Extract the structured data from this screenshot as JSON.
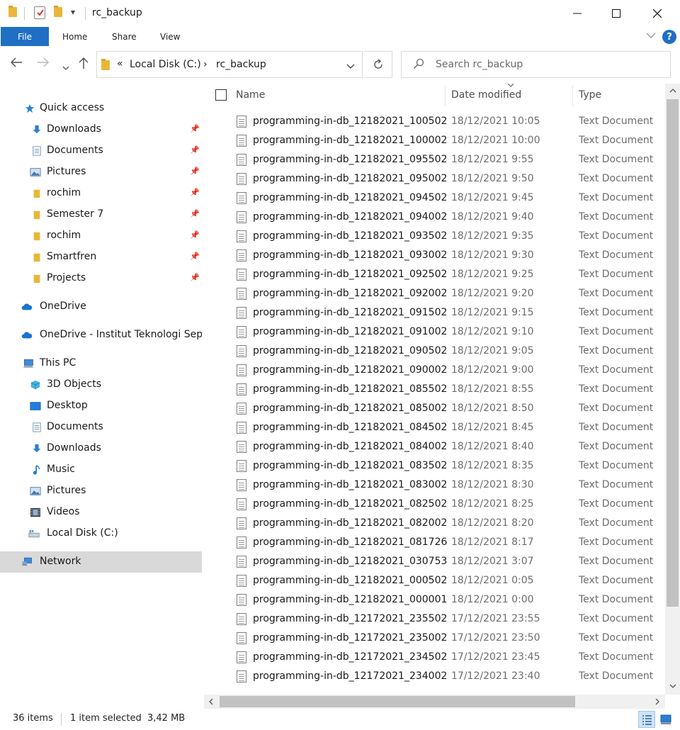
{
  "window": {
    "title": "rc_backup",
    "minimize_icon": "minimize-icon",
    "maximize_icon": "maximize-icon",
    "close_icon": "close-icon",
    "qa_dropdown": "▾"
  },
  "ribbon": {
    "tabs": [
      "File",
      "Home",
      "Share",
      "View"
    ],
    "help": "?"
  },
  "address": {
    "overflow": "«",
    "parts": [
      "Local Disk (C:)",
      "rc_backup"
    ],
    "separator": "›"
  },
  "search": {
    "placeholder": "Search rc_backup"
  },
  "sidebar": {
    "quick_access": "Quick access",
    "quick_items": [
      "Downloads",
      "Documents",
      "Pictures",
      "rochim",
      "Semester 7",
      "rochim",
      "Smartfren",
      "Projects"
    ],
    "onedrive": "OneDrive",
    "onedrive_org": "OneDrive - Institut Teknologi Sepuluh Nopember",
    "this_pc": "This PC",
    "pc_items": [
      "3D Objects",
      "Desktop",
      "Documents",
      "Downloads",
      "Music",
      "Pictures",
      "Videos",
      "Local Disk (C:)"
    ],
    "network": "Network"
  },
  "columns": {
    "name": "Name",
    "date": "Date modified",
    "type": "Type"
  },
  "files": [
    {
      "name": "programming-in-db_12182021_100502",
      "date": "18/12/2021 10:05",
      "type": "Text Document"
    },
    {
      "name": "programming-in-db_12182021_100002",
      "date": "18/12/2021 10:00",
      "type": "Text Document"
    },
    {
      "name": "programming-in-db_12182021_095502",
      "date": "18/12/2021 9:55",
      "type": "Text Document"
    },
    {
      "name": "programming-in-db_12182021_095002",
      "date": "18/12/2021 9:50",
      "type": "Text Document"
    },
    {
      "name": "programming-in-db_12182021_094502",
      "date": "18/12/2021 9:45",
      "type": "Text Document"
    },
    {
      "name": "programming-in-db_12182021_094002",
      "date": "18/12/2021 9:40",
      "type": "Text Document"
    },
    {
      "name": "programming-in-db_12182021_093502",
      "date": "18/12/2021 9:35",
      "type": "Text Document"
    },
    {
      "name": "programming-in-db_12182021_093002",
      "date": "18/12/2021 9:30",
      "type": "Text Document"
    },
    {
      "name": "programming-in-db_12182021_092502",
      "date": "18/12/2021 9:25",
      "type": "Text Document"
    },
    {
      "name": "programming-in-db_12182021_092002",
      "date": "18/12/2021 9:20",
      "type": "Text Document"
    },
    {
      "name": "programming-in-db_12182021_091502",
      "date": "18/12/2021 9:15",
      "type": "Text Document"
    },
    {
      "name": "programming-in-db_12182021_091002",
      "date": "18/12/2021 9:10",
      "type": "Text Document"
    },
    {
      "name": "programming-in-db_12182021_090502",
      "date": "18/12/2021 9:05",
      "type": "Text Document"
    },
    {
      "name": "programming-in-db_12182021_090002",
      "date": "18/12/2021 9:00",
      "type": "Text Document"
    },
    {
      "name": "programming-in-db_12182021_085502",
      "date": "18/12/2021 8:55",
      "type": "Text Document"
    },
    {
      "name": "programming-in-db_12182021_085002",
      "date": "18/12/2021 8:50",
      "type": "Text Document"
    },
    {
      "name": "programming-in-db_12182021_084502",
      "date": "18/12/2021 8:45",
      "type": "Text Document"
    },
    {
      "name": "programming-in-db_12182021_084002",
      "date": "18/12/2021 8:40",
      "type": "Text Document"
    },
    {
      "name": "programming-in-db_12182021_083502",
      "date": "18/12/2021 8:35",
      "type": "Text Document"
    },
    {
      "name": "programming-in-db_12182021_083002",
      "date": "18/12/2021 8:30",
      "type": "Text Document"
    },
    {
      "name": "programming-in-db_12182021_082502",
      "date": "18/12/2021 8:25",
      "type": "Text Document"
    },
    {
      "name": "programming-in-db_12182021_082002",
      "date": "18/12/2021 8:20",
      "type": "Text Document"
    },
    {
      "name": "programming-in-db_12182021_081726",
      "date": "18/12/2021 8:17",
      "type": "Text Document"
    },
    {
      "name": "programming-in-db_12182021_030753",
      "date": "18/12/2021 3:07",
      "type": "Text Document"
    },
    {
      "name": "programming-in-db_12182021_000502",
      "date": "18/12/2021 0:05",
      "type": "Text Document"
    },
    {
      "name": "programming-in-db_12182021_000001",
      "date": "18/12/2021 0:00",
      "type": "Text Document"
    },
    {
      "name": "programming-in-db_12172021_235502",
      "date": "17/12/2021 23:55",
      "type": "Text Document"
    },
    {
      "name": "programming-in-db_12172021_235002",
      "date": "17/12/2021 23:50",
      "type": "Text Document"
    },
    {
      "name": "programming-in-db_12172021_234502",
      "date": "17/12/2021 23:45",
      "type": "Text Document"
    },
    {
      "name": "programming-in-db_12172021_234002",
      "date": "17/12/2021 23:40",
      "type": "Text Document"
    }
  ],
  "status": {
    "item_count": "36 items",
    "selection": "1 item selected",
    "size": "3,42 MB"
  },
  "colors": {
    "accent": "#1f6fc5",
    "folder": "#e8b73a",
    "selected_nav": "#d9d9d9"
  }
}
